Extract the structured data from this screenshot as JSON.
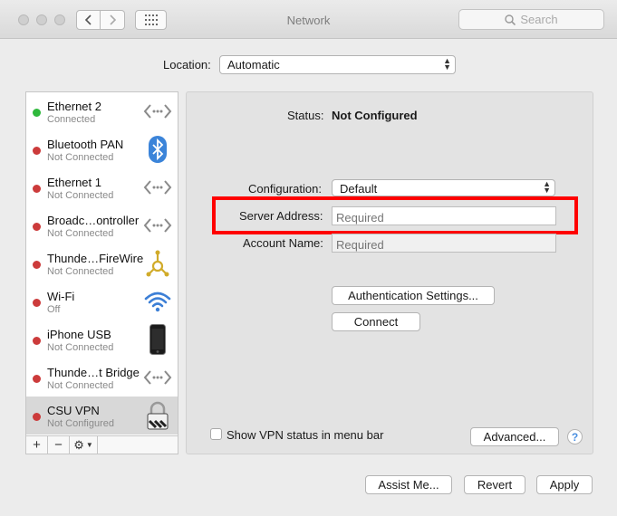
{
  "window": {
    "title": "Network"
  },
  "search": {
    "placeholder": "Search",
    "icon": "magnifier-icon"
  },
  "location": {
    "label": "Location:",
    "value": "Automatic"
  },
  "services": [
    {
      "name": "Ethernet 2",
      "status": "Connected",
      "status_color": "#2fb83c",
      "icon": "ethernet-arrows-icon"
    },
    {
      "name": "Bluetooth PAN",
      "status": "Not Connected",
      "status_color": "#cc3b3b",
      "icon": "bluetooth-icon"
    },
    {
      "name": "Ethernet 1",
      "status": "Not Connected",
      "status_color": "#cc3b3b",
      "icon": "ethernet-arrows-icon"
    },
    {
      "name": "Broadc…ontroller",
      "status": "Not Connected",
      "status_color": "#cc3b3b",
      "icon": "ethernet-arrows-icon"
    },
    {
      "name": "Thunde…FireWire",
      "status": "Not Connected",
      "status_color": "#cc3b3b",
      "icon": "firewire-icon"
    },
    {
      "name": "Wi-Fi",
      "status": "Off",
      "status_color": "#cc3b3b",
      "icon": "wifi-icon"
    },
    {
      "name": "iPhone USB",
      "status": "Not Connected",
      "status_color": "#cc3b3b",
      "icon": "iphone-icon"
    },
    {
      "name": "Thunde…t Bridge",
      "status": "Not Connected",
      "status_color": "#cc3b3b",
      "icon": "ethernet-arrows-icon"
    },
    {
      "name": "CSU VPN",
      "status": "Not Configured",
      "status_color": "#cc3b3b",
      "icon": "vpn-lock-icon",
      "selected": true
    }
  ],
  "list_controls": {
    "add": "+",
    "remove": "−",
    "gear": "⚙"
  },
  "detail": {
    "status_label": "Status:",
    "status_value": "Not Configured",
    "configuration_label": "Configuration:",
    "configuration_value": "Default",
    "server_address_label": "Server Address:",
    "server_address_placeholder": "Required",
    "account_name_label": "Account Name:",
    "account_name_placeholder": "Required",
    "auth_button": "Authentication Settings...",
    "connect_button": "Connect",
    "show_vpn_status_label": "Show VPN status in menu bar",
    "show_vpn_status_checked": false,
    "advanced_button": "Advanced...",
    "help_button": "?"
  },
  "footer": {
    "assist": "Assist Me...",
    "revert": "Revert",
    "apply": "Apply"
  },
  "colors": {
    "highlight": "#ff0000",
    "connected": "#2fb83c",
    "disconnected": "#cc3b3b"
  }
}
